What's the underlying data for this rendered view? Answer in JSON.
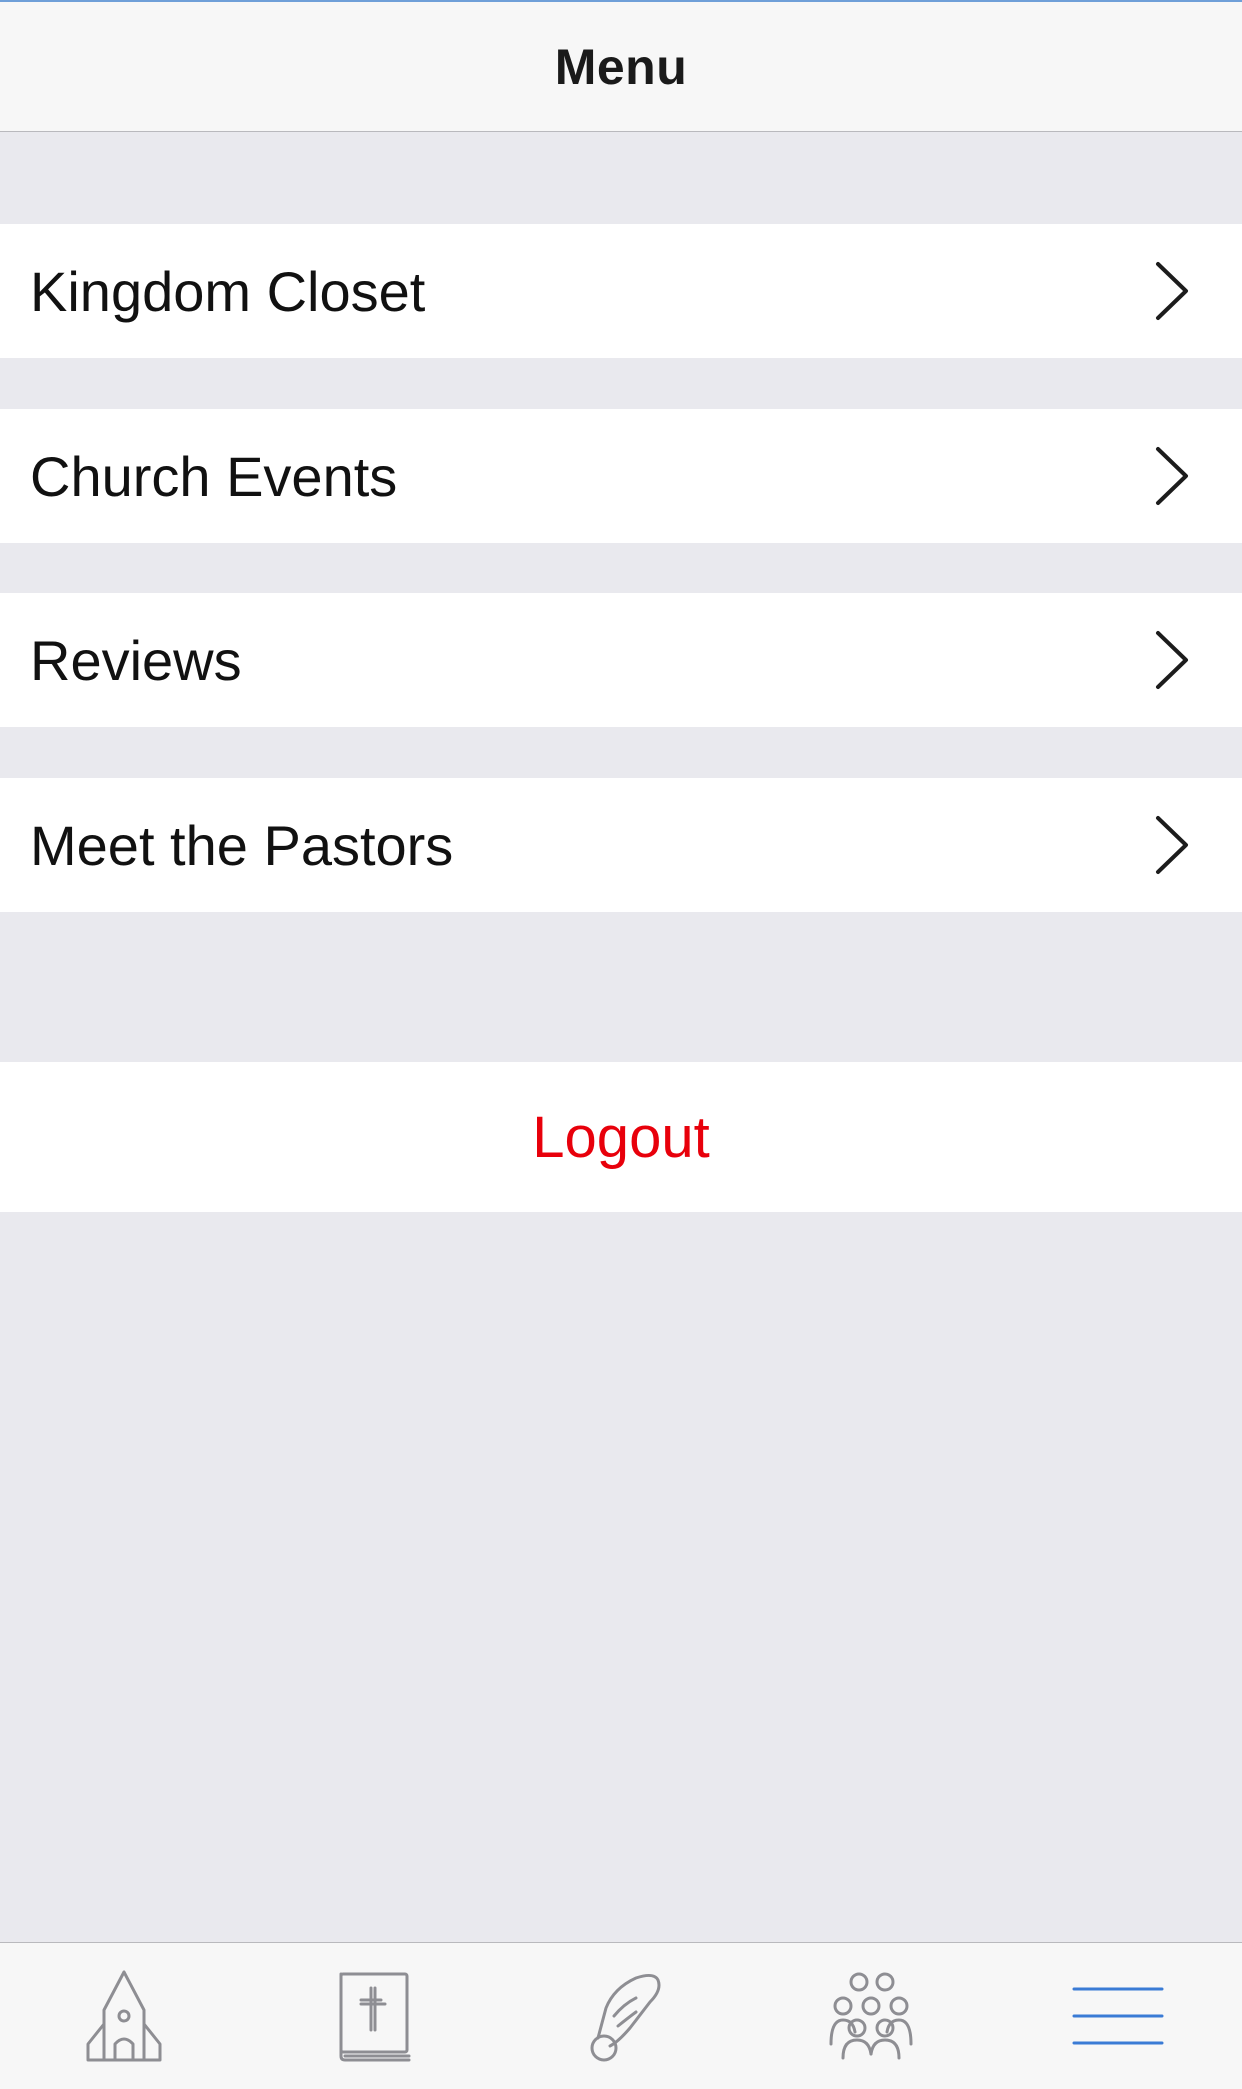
{
  "nav": {
    "title": "Menu"
  },
  "menu": {
    "items": [
      {
        "label": "Kingdom Closet"
      },
      {
        "label": "Church Events"
      },
      {
        "label": "Reviews"
      },
      {
        "label": "Meet the Pastors"
      }
    ],
    "logout_label": "Logout"
  },
  "tabbar": {
    "tabs": [
      {
        "icon": "church-icon",
        "selected": false
      },
      {
        "icon": "bible-icon",
        "selected": false
      },
      {
        "icon": "praying-hands-icon",
        "selected": false
      },
      {
        "icon": "group-icon",
        "selected": false
      },
      {
        "icon": "menu-icon",
        "selected": true
      }
    ]
  },
  "colors": {
    "background": "#e9e9ee",
    "logout": "#e8000b",
    "tab_active": "#3a7bd5",
    "tab_inactive": "#8e8e93"
  }
}
